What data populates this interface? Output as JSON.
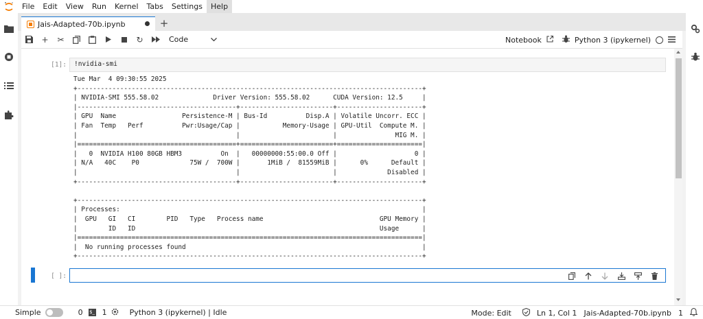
{
  "menu": {
    "items": [
      "File",
      "Edit",
      "View",
      "Run",
      "Kernel",
      "Tabs",
      "Settings",
      "Help"
    ],
    "active": "Help"
  },
  "tab": {
    "title": "Jais-Adapted-70b.ipynb"
  },
  "toolbar": {
    "cell_type": "Code",
    "notebook_label": "Notebook",
    "kernel_name": "Python 3 (ipykernel)"
  },
  "cells": {
    "first_prompt": "[1]:",
    "first_source": "!nvidia-smi",
    "output_lines": [
      "Tue Mar  4 09:30:55 2025",
      "+-----------------------------------------------------------------------------------------+",
      "| NVIDIA-SMI 555.58.02              Driver Version: 555.58.02      CUDA Version: 12.5     |",
      "|-----------------------------------------+------------------------+----------------------+",
      "| GPU  Name                 Persistence-M | Bus-Id          Disp.A | Volatile Uncorr. ECC |",
      "| Fan  Temp   Perf          Pwr:Usage/Cap |           Memory-Usage | GPU-Util  Compute M. |",
      "|                                         |                        |               MIG M. |",
      "|=========================================+========================+======================|",
      "|   0  NVIDIA H100 80GB HBM3          On  |   00000000:55:00.0 Off |                    0 |",
      "| N/A   40C    P0             75W /  700W |       1MiB /  81559MiB |      0%      Default |",
      "|                                         |                        |             Disabled |",
      "+-----------------------------------------+------------------------+----------------------+",
      "",
      "+-----------------------------------------------------------------------------------------+",
      "| Processes:                                                                              |",
      "|  GPU   GI   CI        PID   Type   Process name                              GPU Memory |",
      "|        ID   ID                                                               Usage      |",
      "|=========================================================================================|",
      "|  No running processes found                                                             |",
      "+-----------------------------------------------------------------------------------------+"
    ],
    "second_prompt": "[ ]:"
  },
  "status": {
    "mode_label": "Simple",
    "terminals_count": "0",
    "kernels_count": "1",
    "kernel_status": "Python 3 (ipykernel) | Idle",
    "edit_mode": "Mode: Edit",
    "cursor": "Ln 1, Col 1",
    "file_name": "Jais-Adapted-70b.ipynb",
    "notifications": "1"
  },
  "colors": {
    "accent": "#1976d2",
    "logo": "#f57c00"
  }
}
